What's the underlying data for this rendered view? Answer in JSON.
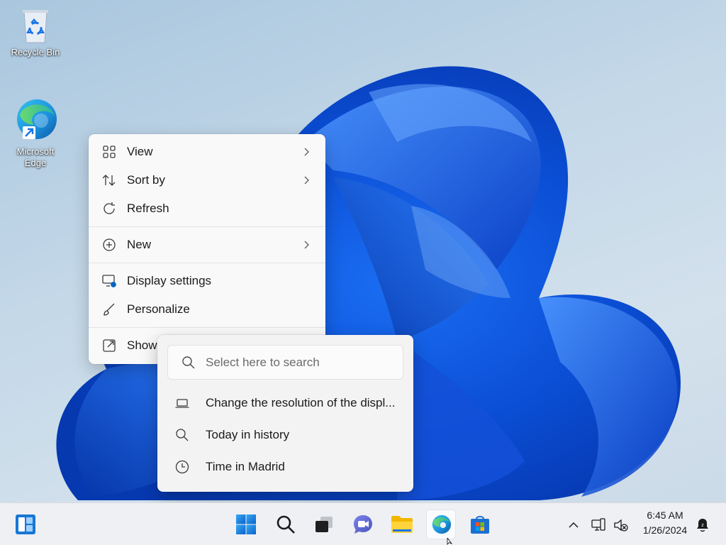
{
  "desktop": {
    "icons": [
      {
        "label": "Recycle Bin",
        "icon": "recycle-bin-icon"
      },
      {
        "label": "Microsoft Edge",
        "icon": "edge-icon"
      }
    ]
  },
  "context_menu": {
    "items": [
      {
        "label": "View",
        "icon": "grid-icon",
        "submenu": true
      },
      {
        "label": "Sort by",
        "icon": "sort-icon",
        "submenu": true
      },
      {
        "label": "Refresh",
        "icon": "refresh-icon",
        "submenu": false
      },
      {
        "label": "New",
        "icon": "plus-circle-icon",
        "submenu": true
      },
      {
        "label": "Display settings",
        "icon": "display-settings-icon",
        "submenu": false
      },
      {
        "label": "Personalize",
        "icon": "brush-icon",
        "submenu": false
      },
      {
        "label": "Show",
        "icon": "external-icon",
        "submenu": false
      }
    ]
  },
  "search_popup": {
    "placeholder": "Select here to search",
    "results": [
      {
        "label": "Change the resolution of the displ...",
        "icon": "laptop-icon"
      },
      {
        "label": "Today in history",
        "icon": "search-icon"
      },
      {
        "label": "Time in Madrid",
        "icon": "clock-icon"
      }
    ]
  },
  "taskbar": {
    "apps": [
      "widgets",
      "start",
      "search",
      "task-view",
      "teams-chat",
      "file-explorer",
      "edge",
      "microsoft-store"
    ],
    "active_app": "edge",
    "clock": {
      "time": "6:45 AM",
      "date": "1/26/2024"
    }
  },
  "colors": {
    "accent": "#0067c0",
    "menu_bg": "#f9f9f9",
    "taskbar_bg": "#eef0f3"
  }
}
